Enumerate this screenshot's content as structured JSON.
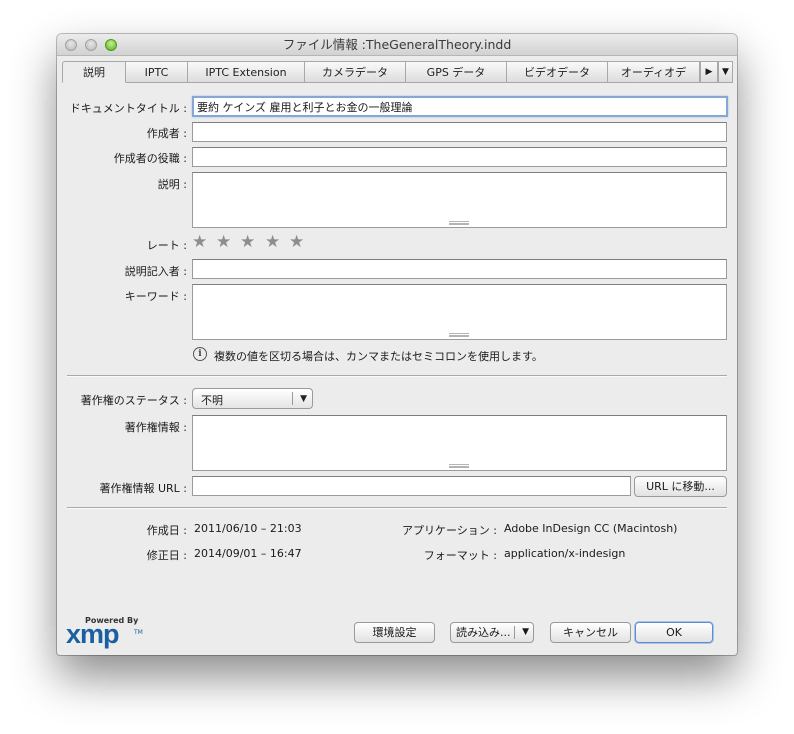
{
  "window": {
    "title": "ファイル情報 :TheGeneralTheory.indd"
  },
  "tabs": [
    "説明",
    "IPTC",
    "IPTC Extension",
    "カメラデータ",
    "GPS データ",
    "ビデオデータ",
    "オーディオデ"
  ],
  "tab_controls": {
    "next": "▶",
    "menu": "▼"
  },
  "fields": {
    "document_title": {
      "label": "ドキュメントタイトル :",
      "value": "要約 ケインズ 雇用と利子とお金の一般理論"
    },
    "author": {
      "label": "作成者 :",
      "value": ""
    },
    "author_title": {
      "label": "作成者の役職 :",
      "value": ""
    },
    "description": {
      "label": "説明 :",
      "value": ""
    },
    "rating": {
      "label": "レート :",
      "stars": 5,
      "filled": 0
    },
    "description_writer": {
      "label": "説明記入者 :",
      "value": ""
    },
    "keywords": {
      "label": "キーワード :",
      "value": ""
    },
    "hint": "複数の値を区切る場合は、カンマまたはセミコロンを使用します。",
    "copyright_status": {
      "label": "著作権のステータス :",
      "value": "不明"
    },
    "copyright_notice": {
      "label": "著作権情報 :",
      "value": ""
    },
    "copyright_url": {
      "label": "著作権情報 URL :",
      "value": "",
      "button": "URL に移動..."
    }
  },
  "meta": {
    "created_label": "作成日 :",
    "created_value": "2011/06/10 – 21:03",
    "modified_label": "修正日 :",
    "modified_value": "2014/09/01 – 16:47",
    "application_label": "アプリケーション :",
    "application_value": "Adobe InDesign CC (Macintosh)",
    "format_label": "フォーマット :",
    "format_value": "application/x-indesign"
  },
  "footer": {
    "powered_by": "Powered By",
    "logo": "xmp",
    "logo_tm": "TM",
    "preferences": "環境設定",
    "import": "読み込み...",
    "cancel": "キャンセル",
    "ok": "OK"
  },
  "colors": {
    "focus": "#84a7d3",
    "xmp_blue": "#1b5fa3",
    "window_bg": "#ececec"
  }
}
